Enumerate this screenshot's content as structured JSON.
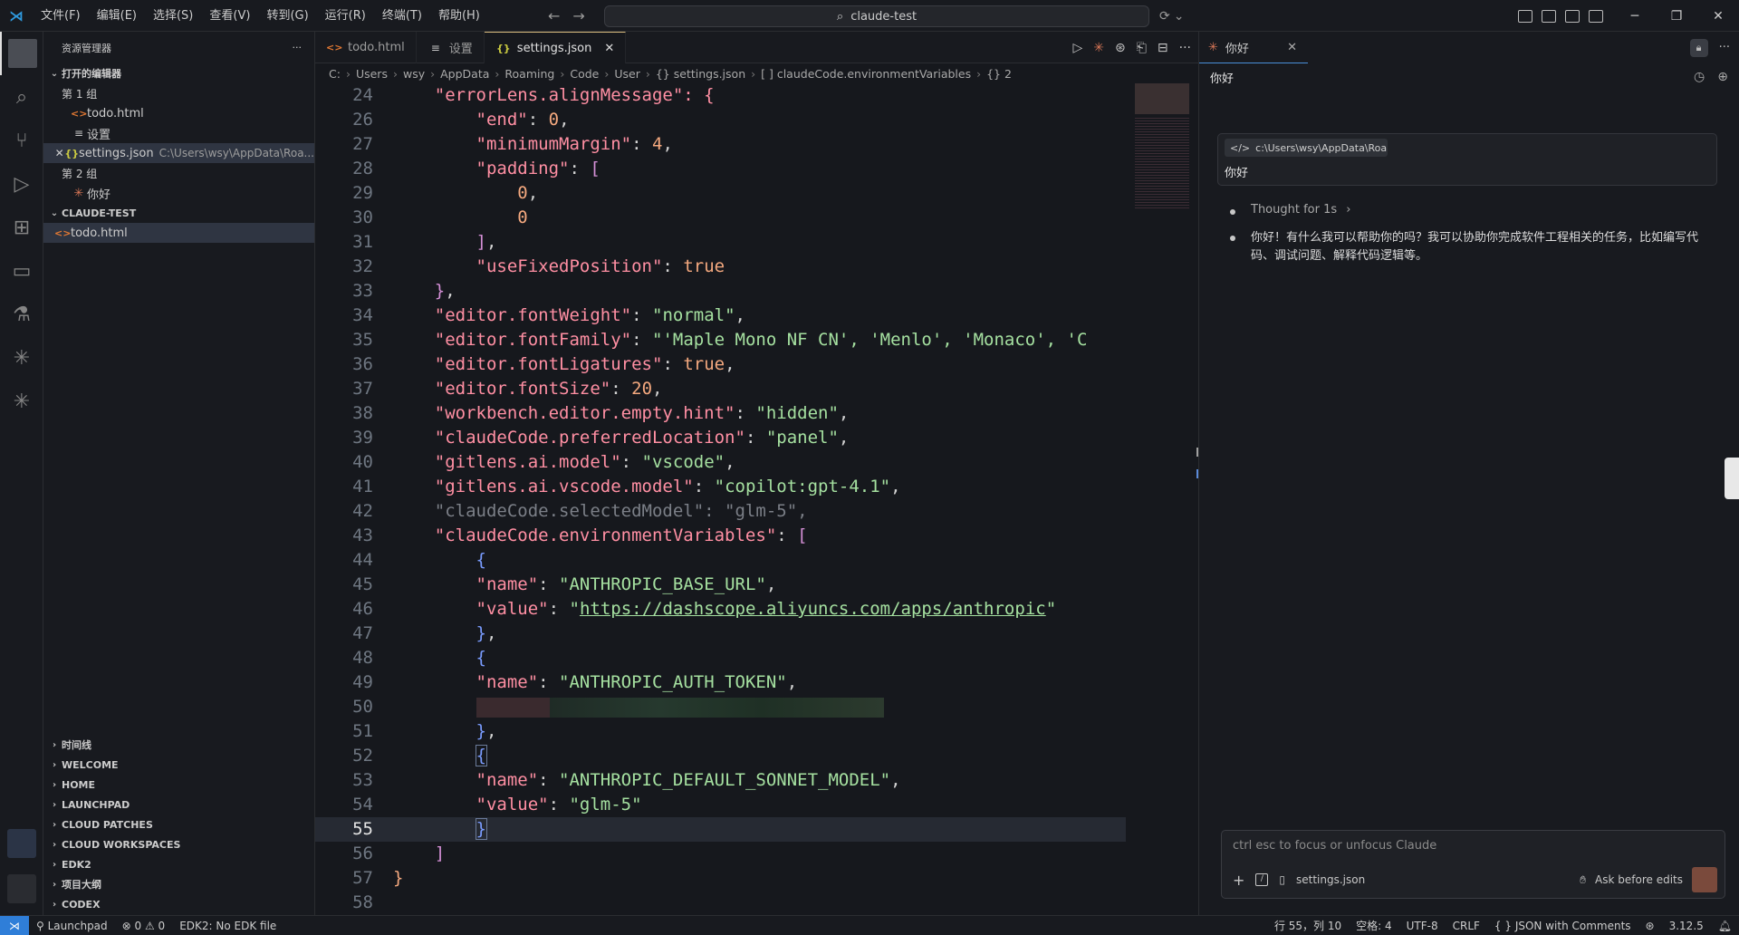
{
  "titlebar": {
    "menu": [
      "文件(F)",
      "编辑(E)",
      "选择(S)",
      "查看(V)",
      "转到(G)",
      "运行(R)",
      "终端(T)",
      "帮助(H)"
    ],
    "search_text": "claude-test"
  },
  "sidebar": {
    "title": "资源管理器",
    "more": "···",
    "open_editors": "打开的编辑器",
    "group1": "第 1 组",
    "group1_items": [
      "todo.html",
      "设置",
      "settings.json"
    ],
    "settings_path": "C:\\Users\\wsy\\AppData\\Roa...",
    "group2": "第 2 组",
    "group2_items": [
      "你好"
    ],
    "folder": "CLAUDE-TEST",
    "folder_items": [
      "todo.html"
    ],
    "bottom_sections": [
      "时间线",
      "WELCOME",
      "HOME",
      "LAUNCHPAD",
      "CLOUD PATCHES",
      "CLOUD WORKSPACES",
      "EDK2",
      "项目大纲",
      "CODEX"
    ]
  },
  "editor": {
    "tabs": [
      "todo.html",
      "设置",
      "settings.json"
    ],
    "active_tab": "settings.json",
    "breadcrumb": [
      "C:",
      "Users",
      "wsy",
      "AppData",
      "Roaming",
      "Code",
      "User",
      "{} settings.json",
      "[ ] claudeCode.environmentVariables",
      "{} 2"
    ],
    "lines": {
      "l24": "\"errorLens.alignMessage\": {",
      "l26a": "\"end\"",
      "l26b": "0",
      "l27a": "\"minimumMargin\"",
      "l27b": "4",
      "l28a": "\"padding\"",
      "l29": "0",
      "l30": "0",
      "l32a": "\"useFixedPosition\"",
      "l32b": "true",
      "l34a": "\"editor.fontWeight\"",
      "l34b": "\"normal\"",
      "l35a": "\"editor.fontFamily\"",
      "l35b": "\"'Maple Mono NF CN', 'Menlo', 'Monaco', 'C",
      "l36a": "\"editor.fontLigatures\"",
      "l36b": "true",
      "l37a": "\"editor.fontSize\"",
      "l37b": "20",
      "l38a": "\"workbench.editor.empty.hint\"",
      "l38b": "\"hidden\"",
      "l39a": "\"claudeCode.preferredLocation\"",
      "l39b": "\"panel\"",
      "l40a": "\"gitlens.ai.model\"",
      "l40b": "\"vscode\"",
      "l41a": "\"gitlens.ai.vscode.model\"",
      "l41b": "\"copilot:gpt-4.1\"",
      "l42": "\"claudeCode.selectedModel\": \"glm-5\",",
      "l43a": "\"claudeCode.environmentVariables\"",
      "l45a": "\"name\"",
      "l45b": "\"ANTHROPIC_BASE_URL\"",
      "l46a": "\"value\"",
      "l46b": "https://dashscope.aliyuncs.com/apps/anthropic",
      "l49a": "\"name\"",
      "l49b": "\"ANTHROPIC_AUTH_TOKEN\"",
      "l53a": "\"name\"",
      "l53b": "\"ANTHROPIC_DEFAULT_SONNET_MODEL\"",
      "l54a": "\"value\"",
      "l54b": "\"glm-5\""
    }
  },
  "chat": {
    "tab_title": "你好",
    "conversation_title": "你好",
    "attached_file": "c:\\Users\\wsy\\AppData\\Roa...",
    "user_message": "你好",
    "thought": "Thought for 1s",
    "reply": "你好！有什么我可以帮助你的吗？我可以协助你完成软件工程相关的任务，比如编写代码、调试问题、解释代码逻辑等。",
    "input_placeholder": "ctrl esc to focus or unfocus Claude",
    "context_file": "settings.json",
    "mode": "Ask before edits"
  },
  "statusbar": {
    "launchpad": "Launchpad",
    "problems": "⊗ 0 ⚠ 0",
    "edk": "EDK2: No EDK file",
    "position": "行 55，列 10",
    "spaces": "空格: 4",
    "encoding": "UTF-8",
    "eol": "CRLF",
    "language": "{ } JSON with Comments",
    "version": "3.12.5"
  },
  "colors": {
    "accent_tab": "#d7ba7d",
    "remote": "#2f7ed8",
    "claude": "#d97757"
  }
}
